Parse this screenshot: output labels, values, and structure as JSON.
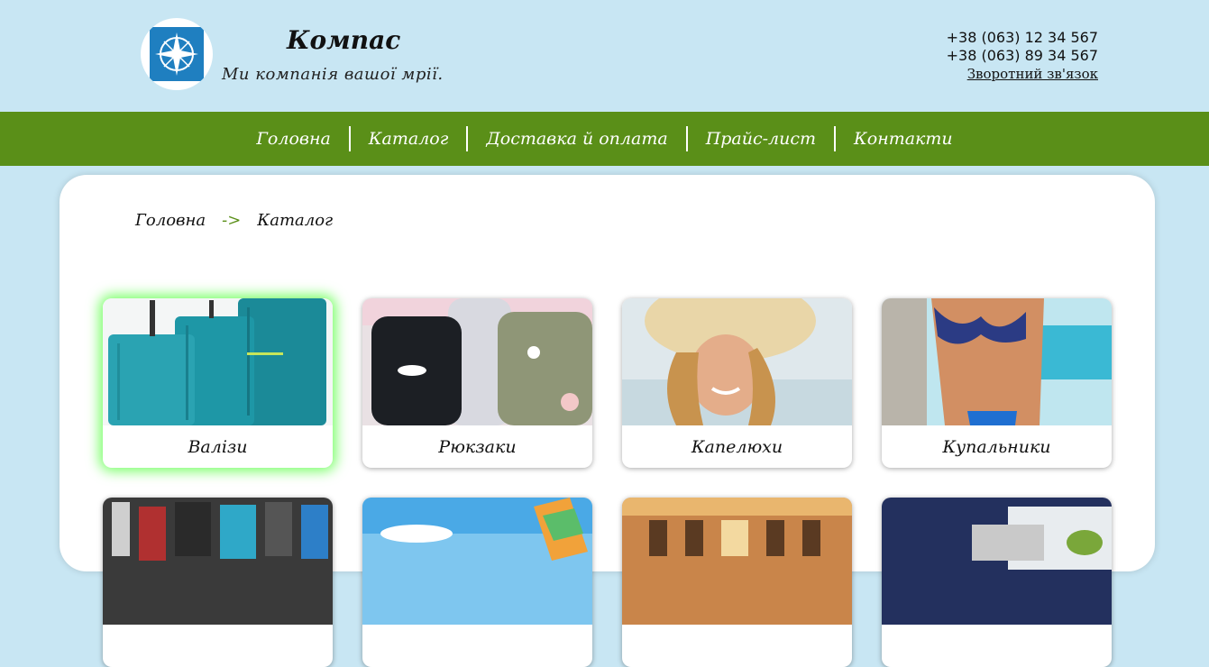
{
  "header": {
    "brand": "Компас",
    "tagline": "Ми компанія вашої мрії.",
    "phones": [
      "+38 (063) 12 34 567",
      "+38 (063) 89 34 567"
    ],
    "feedback_link": "Зворотний зв'язок",
    "logo_icon": "compass-rose-icon"
  },
  "nav": {
    "items": [
      "Головна",
      "Каталог",
      "Доставка й оплата",
      "Прайс-лист",
      "Контакти"
    ]
  },
  "breadcrumb": {
    "home": "Головна",
    "separator": "->",
    "current": "Каталог"
  },
  "catalog": {
    "items": [
      {
        "label": "Валізи",
        "image": "suitcases-photo",
        "highlighted": true
      },
      {
        "label": "Рюкзаки",
        "image": "backpacks-photo",
        "highlighted": false
      },
      {
        "label": "Капелюхи",
        "image": "sun-hat-woman-photo",
        "highlighted": false
      },
      {
        "label": "Купальники",
        "image": "swimsuit-photo",
        "highlighted": false
      },
      {
        "label": "",
        "image": "bags-shop-photo",
        "highlighted": false
      },
      {
        "label": "",
        "image": "beach-photo",
        "highlighted": false
      },
      {
        "label": "",
        "image": "hotel-building-photo",
        "highlighted": false
      },
      {
        "label": "",
        "image": "food-box-photo",
        "highlighted": false
      }
    ]
  },
  "colors": {
    "page_bg": "#c8e6f3",
    "nav_bg": "#5a8f18",
    "accent_arrow": "#5a8f18",
    "highlight_glow": "#7bff6a"
  }
}
